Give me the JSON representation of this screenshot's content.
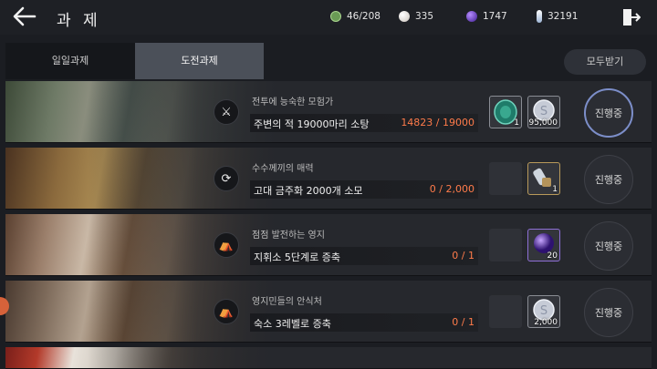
{
  "header": {
    "title": "과 제",
    "back_icon": "back-arrow-icon",
    "exit_icon": "exit-icon",
    "resources": [
      {
        "icon": "green-token-icon",
        "value": "46/208",
        "color": "#7db86a"
      },
      {
        "icon": "pearl-icon",
        "value": "335",
        "color": "#d9d4cf"
      },
      {
        "icon": "purple-orb-icon",
        "value": "1747",
        "color": "#6b3fd6"
      },
      {
        "icon": "crystal-icon",
        "value": "32191"
      }
    ]
  },
  "tabs": [
    {
      "label": "일일과제",
      "selected": false
    },
    {
      "label": "도전과제",
      "selected": true
    }
  ],
  "claim_all_label": "모두받기",
  "quests": [
    {
      "category": "전투에 능숙한 모험가",
      "goal": "주변의 적 19000마리 소탕",
      "progress": "14823 / 19000",
      "icon": "horned-helmet-icon",
      "icon_glyph": "⚔",
      "rewards": [
        {
          "icon": "emerald-relic-icon",
          "qty": "1",
          "color": "#1f7c6a"
        },
        {
          "icon": "silver-coin-icon",
          "qty": "95,000",
          "color": "#c6cbd6"
        }
      ],
      "button": "진행중",
      "active": true
    },
    {
      "category": "수수께끼의 매력",
      "goal": "고대 금주화 2000개 소모",
      "progress": "0 / 2,000",
      "icon": "refresh-icon",
      "icon_glyph": "⟳",
      "rewards": [
        {
          "icon": "gauntlet-item-icon",
          "qty": "1",
          "color": "#b4935a"
        }
      ],
      "button": "진행중",
      "active": false
    },
    {
      "category": "점점 발전하는 영지",
      "goal": "지휘소 5단계로 증축",
      "progress": "0 / 1",
      "icon": "tent-icon",
      "icon_glyph": "⛺",
      "rewards": [
        {
          "icon": "purple-orb-icon",
          "qty": "20",
          "color": "#5a2fb8"
        }
      ],
      "button": "진행중",
      "active": false
    },
    {
      "category": "영지민들의 안식처",
      "goal": "숙소 3레벨로 증축",
      "progress": "0 / 1",
      "icon": "tent-icon",
      "icon_glyph": "⛺",
      "rewards": [
        {
          "icon": "silver-coin-icon",
          "qty": "2,000",
          "color": "#c6cbd6"
        }
      ],
      "button": "진행중",
      "active": false
    }
  ]
}
